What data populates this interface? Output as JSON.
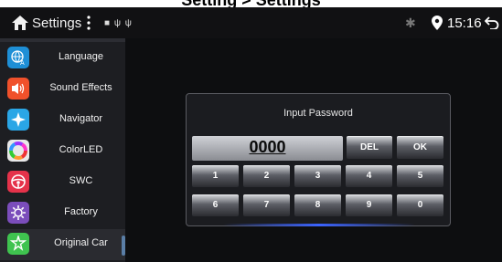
{
  "caption": "Setting > Settings",
  "status_bar": {
    "title": "Settings",
    "notification_icons": "■ ψ ψ",
    "time": "15:16"
  },
  "sidebar": {
    "items": [
      {
        "label": "Language",
        "icon": "globe-language-icon",
        "color": "#1e8fd6"
      },
      {
        "label": "Sound Effects",
        "icon": "speaker-icon",
        "color": "#f0512b"
      },
      {
        "label": "Navigator",
        "icon": "compass-star-icon",
        "color": "#2aa6e6"
      },
      {
        "label": "ColorLED",
        "icon": "color-wheel-icon",
        "color": "#e8e8e8"
      },
      {
        "label": "SWC",
        "icon": "steering-wheel-icon",
        "color": "#e5324a"
      },
      {
        "label": "Factory",
        "icon": "factory-gear-icon",
        "color": "#7b4dbb"
      },
      {
        "label": "Original Car",
        "icon": "car-settings-icon",
        "color": "#3fc34f"
      }
    ]
  },
  "dialog": {
    "title": "Input Password",
    "password_value": "0000",
    "del_label": "DEL",
    "ok_label": "OK",
    "keys_row1": [
      "1",
      "2",
      "3",
      "4",
      "5"
    ],
    "keys_row2": [
      "6",
      "7",
      "8",
      "9",
      "0"
    ]
  },
  "colors": {
    "accent_glow": "#3b63ff",
    "sidebar_bg": "#1d1e22",
    "background": "#0b0b0d"
  }
}
